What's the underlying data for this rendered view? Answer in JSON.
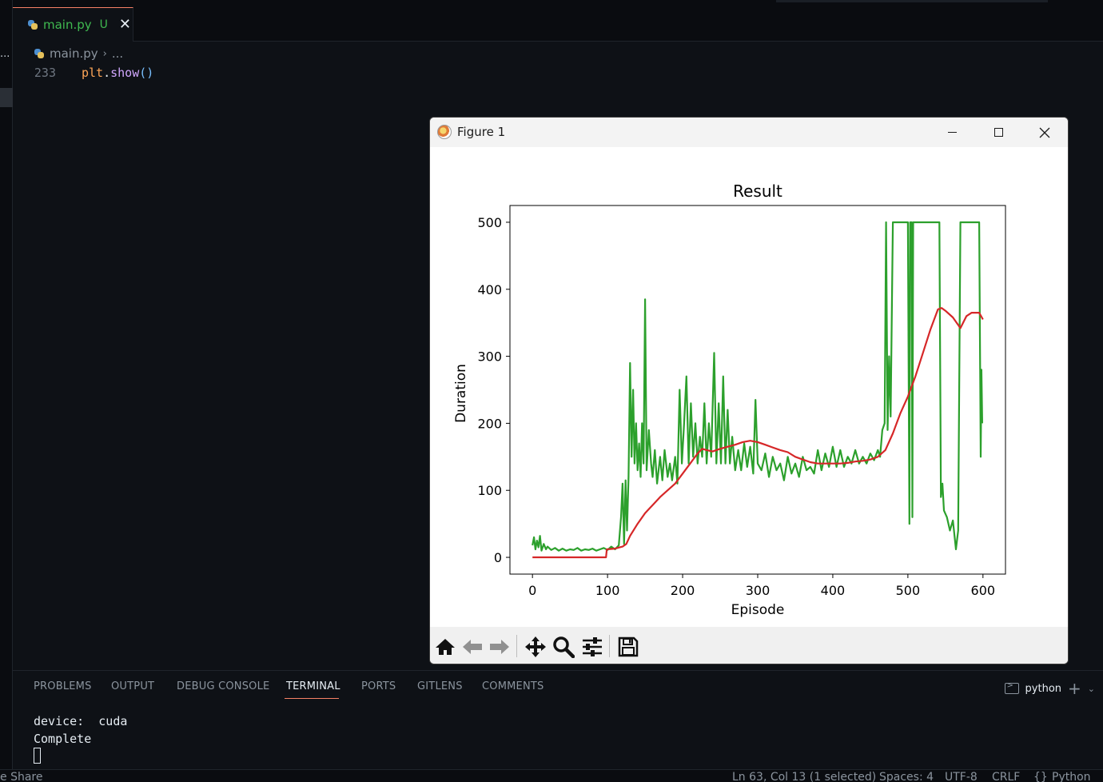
{
  "editor": {
    "tab": {
      "filename": "main.py",
      "badge": "U",
      "close_glyph": "✕"
    },
    "breadcrumb": {
      "file": "main.py",
      "separator": "›",
      "more": "..."
    },
    "code_line": {
      "number": "233",
      "obj": "plt",
      "dot": ".",
      "fn": "show",
      "parens": "()"
    },
    "activity_more": "..."
  },
  "figure_window": {
    "title": "Figure 1",
    "toolbar_buttons": [
      "home-icon",
      "back-icon",
      "forward-icon",
      "pan-icon",
      "zoom-icon",
      "configure-subplots-icon",
      "save-icon"
    ]
  },
  "chart_data": {
    "type": "line",
    "title": "Result",
    "xlabel": "Episode",
    "ylabel": "Duration",
    "xlim": [
      -30,
      630
    ],
    "ylim": [
      -25,
      525
    ],
    "xticks": [
      0,
      100,
      200,
      300,
      400,
      500,
      600
    ],
    "yticks": [
      0,
      100,
      200,
      300,
      400,
      500
    ],
    "grid": false,
    "series": [
      {
        "color": "#2ca02c",
        "role": "episode duration",
        "points": [
          [
            0,
            18
          ],
          [
            2,
            30
          ],
          [
            4,
            12
          ],
          [
            6,
            25
          ],
          [
            8,
            15
          ],
          [
            10,
            32
          ],
          [
            12,
            10
          ],
          [
            15,
            20
          ],
          [
            18,
            12
          ],
          [
            20,
            16
          ],
          [
            25,
            11
          ],
          [
            30,
            14
          ],
          [
            35,
            10
          ],
          [
            40,
            13
          ],
          [
            45,
            10
          ],
          [
            50,
            12
          ],
          [
            55,
            11
          ],
          [
            60,
            14
          ],
          [
            65,
            10
          ],
          [
            70,
            12
          ],
          [
            75,
            11
          ],
          [
            80,
            13
          ],
          [
            85,
            10
          ],
          [
            90,
            12
          ],
          [
            95,
            14
          ],
          [
            100,
            11
          ],
          [
            105,
            16
          ],
          [
            110,
            12
          ],
          [
            115,
            18
          ],
          [
            118,
            60
          ],
          [
            120,
            110
          ],
          [
            122,
            20
          ],
          [
            124,
            115
          ],
          [
            126,
            40
          ],
          [
            128,
            120
          ],
          [
            130,
            290
          ],
          [
            132,
            150
          ],
          [
            134,
            250
          ],
          [
            136,
            140
          ],
          [
            138,
            200
          ],
          [
            140,
            130
          ],
          [
            142,
            170
          ],
          [
            144,
            120
          ],
          [
            146,
            200
          ],
          [
            148,
            140
          ],
          [
            150,
            385
          ],
          [
            152,
            130
          ],
          [
            155,
            190
          ],
          [
            158,
            140
          ],
          [
            160,
            120
          ],
          [
            163,
            160
          ],
          [
            166,
            110
          ],
          [
            170,
            150
          ],
          [
            173,
            115
          ],
          [
            176,
            160
          ],
          [
            180,
            120
          ],
          [
            183,
            140
          ],
          [
            186,
            115
          ],
          [
            190,
            150
          ],
          [
            193,
            110
          ],
          [
            196,
            250
          ],
          [
            199,
            140
          ],
          [
            202,
            200
          ],
          [
            205,
            270
          ],
          [
            208,
            140
          ],
          [
            211,
            230
          ],
          [
            214,
            150
          ],
          [
            217,
            200
          ],
          [
            220,
            140
          ],
          [
            223,
            180
          ],
          [
            226,
            150
          ],
          [
            229,
            230
          ],
          [
            232,
            140
          ],
          [
            235,
            200
          ],
          [
            238,
            150
          ],
          [
            242,
            305
          ],
          [
            245,
            140
          ],
          [
            248,
            230
          ],
          [
            251,
            140
          ],
          [
            254,
            270
          ],
          [
            257,
            140
          ],
          [
            260,
            220
          ],
          [
            263,
            140
          ],
          [
            266,
            180
          ],
          [
            270,
            130
          ],
          [
            274,
            160
          ],
          [
            278,
            130
          ],
          [
            282,
            170
          ],
          [
            286,
            135
          ],
          [
            290,
            165
          ],
          [
            294,
            125
          ],
          [
            297,
            235
          ],
          [
            300,
            140
          ],
          [
            305,
            130
          ],
          [
            310,
            155
          ],
          [
            315,
            120
          ],
          [
            320,
            150
          ],
          [
            325,
            130
          ],
          [
            330,
            140
          ],
          [
            335,
            115
          ],
          [
            340,
            150
          ],
          [
            345,
            125
          ],
          [
            350,
            140
          ],
          [
            355,
            120
          ],
          [
            360,
            150
          ],
          [
            365,
            130
          ],
          [
            370,
            135
          ],
          [
            375,
            125
          ],
          [
            380,
            160
          ],
          [
            385,
            130
          ],
          [
            390,
            155
          ],
          [
            395,
            135
          ],
          [
            400,
            165
          ],
          [
            405,
            135
          ],
          [
            410,
            160
          ],
          [
            415,
            135
          ],
          [
            420,
            150
          ],
          [
            425,
            140
          ],
          [
            430,
            160
          ],
          [
            435,
            140
          ],
          [
            440,
            150
          ],
          [
            445,
            140
          ],
          [
            450,
            155
          ],
          [
            455,
            145
          ],
          [
            460,
            160
          ],
          [
            463,
            150
          ],
          [
            466,
            190
          ],
          [
            469,
            200
          ],
          [
            471,
            500
          ],
          [
            473,
            190
          ],
          [
            475,
            300
          ],
          [
            477,
            210
          ],
          [
            480,
            500
          ],
          [
            483,
            500
          ],
          [
            490,
            500
          ],
          [
            500,
            500
          ],
          [
            502,
            50
          ],
          [
            503,
            500
          ],
          [
            505,
            500
          ],
          [
            506,
            60
          ],
          [
            507,
            500
          ],
          [
            510,
            500
          ],
          [
            520,
            500
          ],
          [
            530,
            500
          ],
          [
            540,
            500
          ],
          [
            542,
            500
          ],
          [
            544,
            90
          ],
          [
            546,
            110
          ],
          [
            548,
            70
          ],
          [
            552,
            60
          ],
          [
            556,
            40
          ],
          [
            560,
            55
          ],
          [
            564,
            12
          ],
          [
            567,
            40
          ],
          [
            570,
            500
          ],
          [
            575,
            500
          ],
          [
            580,
            500
          ],
          [
            590,
            500
          ],
          [
            595,
            500
          ],
          [
            597,
            150
          ],
          [
            598,
            280
          ],
          [
            599,
            200
          ]
        ]
      },
      {
        "color": "#d62728",
        "role": "100-episode moving average",
        "points": [
          [
            0,
            0
          ],
          [
            50,
            0
          ],
          [
            98,
            0
          ],
          [
            99,
            12
          ],
          [
            110,
            13
          ],
          [
            120,
            16
          ],
          [
            125,
            20
          ],
          [
            130,
            32
          ],
          [
            140,
            50
          ],
          [
            150,
            66
          ],
          [
            160,
            78
          ],
          [
            170,
            90
          ],
          [
            180,
            100
          ],
          [
            190,
            110
          ],
          [
            200,
            125
          ],
          [
            210,
            140
          ],
          [
            220,
            155
          ],
          [
            226,
            162
          ],
          [
            232,
            160
          ],
          [
            240,
            158
          ],
          [
            250,
            162
          ],
          [
            260,
            165
          ],
          [
            270,
            168
          ],
          [
            280,
            172
          ],
          [
            290,
            174
          ],
          [
            300,
            172
          ],
          [
            310,
            168
          ],
          [
            320,
            164
          ],
          [
            330,
            160
          ],
          [
            340,
            157
          ],
          [
            350,
            150
          ],
          [
            360,
            146
          ],
          [
            370,
            142
          ],
          [
            380,
            140
          ],
          [
            390,
            140
          ],
          [
            400,
            140
          ],
          [
            410,
            140
          ],
          [
            420,
            141
          ],
          [
            430,
            143
          ],
          [
            440,
            144
          ],
          [
            450,
            146
          ],
          [
            460,
            150
          ],
          [
            465,
            155
          ],
          [
            470,
            160
          ],
          [
            480,
            185
          ],
          [
            490,
            215
          ],
          [
            500,
            240
          ],
          [
            510,
            270
          ],
          [
            520,
            305
          ],
          [
            530,
            340
          ],
          [
            540,
            370
          ],
          [
            545,
            372
          ],
          [
            550,
            368
          ],
          [
            560,
            358
          ],
          [
            570,
            342
          ],
          [
            578,
            360
          ],
          [
            585,
            365
          ],
          [
            595,
            365
          ],
          [
            600,
            355
          ]
        ]
      }
    ]
  },
  "panel": {
    "tabs": [
      "PROBLEMS",
      "OUTPUT",
      "DEBUG CONSOLE",
      "TERMINAL",
      "PORTS",
      "GITLENS",
      "COMMENTS"
    ],
    "active_tab": "TERMINAL",
    "terminal_name": "python",
    "terminal_lines": [
      "device:  cuda",
      "Complete"
    ]
  },
  "statusbar": {
    "left": "e Share",
    "position": "Ln 63, Col 13 (1 selected)",
    "spaces": "Spaces: 4",
    "encoding": "UTF-8",
    "eol": "CRLF",
    "language": "Python",
    "language_icon": "braces-icon"
  }
}
